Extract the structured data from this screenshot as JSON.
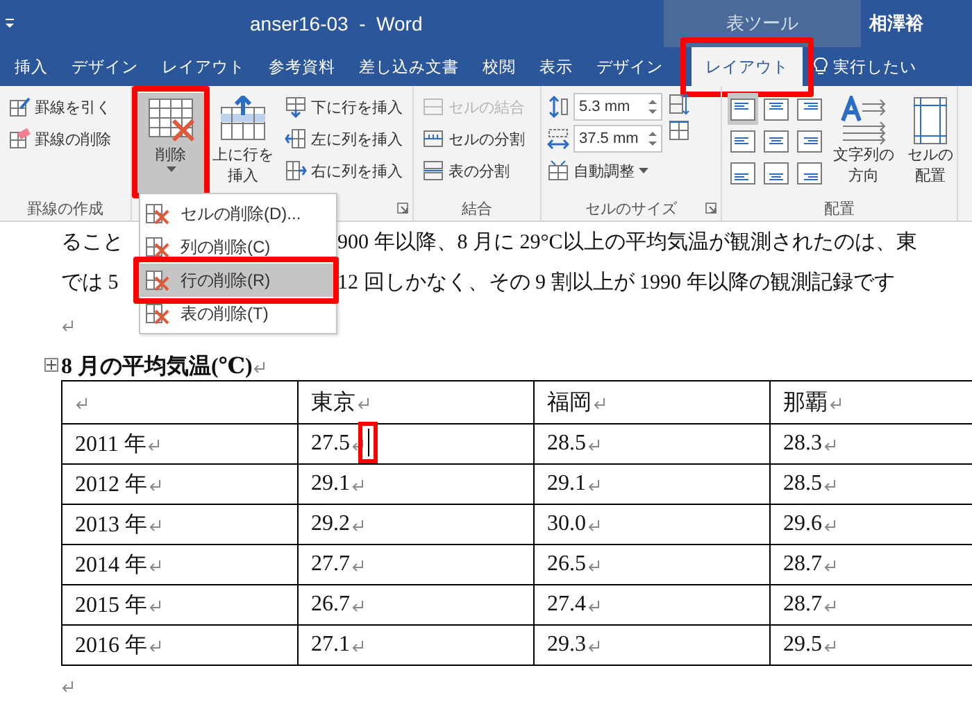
{
  "title_bar": {
    "document_title": "anser16-03  -  Word",
    "context_label": "表ツール",
    "user": "相澤裕"
  },
  "tabs": [
    {
      "label": "挿入",
      "selected": false,
      "highlighted": false
    },
    {
      "label": "デザイン",
      "selected": false,
      "highlighted": false
    },
    {
      "label": "レイアウト",
      "selected": false,
      "highlighted": false
    },
    {
      "label": "参考資料",
      "selected": false,
      "highlighted": false
    },
    {
      "label": "差し込み文書",
      "selected": false,
      "highlighted": false
    },
    {
      "label": "校閲",
      "selected": false,
      "highlighted": false
    },
    {
      "label": "表示",
      "selected": false,
      "highlighted": false
    },
    {
      "label": "デザイン",
      "selected": false,
      "highlighted": false
    },
    {
      "label": "レイアウト",
      "selected": true,
      "highlighted": true
    }
  ],
  "tell_me": {
    "label": "実行したい"
  },
  "ribbon": {
    "groups": [
      {
        "label": "罫線の作成",
        "launcher": false,
        "items": [
          {
            "kind": "small",
            "label": "罫線を引く",
            "disabled": false
          },
          {
            "kind": "small",
            "label": "罫線の削除",
            "disabled": false
          }
        ]
      },
      {
        "launcher": true,
        "items": [
          {
            "kind": "large_menu",
            "lines": [
              "削除"
            ],
            "pressed": true,
            "highlighted": true
          },
          {
            "kind": "large",
            "lines": [
              "上に行を",
              "挿入"
            ]
          },
          {
            "kind": "small",
            "label": "下に行を挿入",
            "disabled": false
          },
          {
            "kind": "small",
            "label": "左に列を挿入",
            "disabled": false
          },
          {
            "kind": "small",
            "label": "右に列を挿入",
            "disabled": false
          }
        ]
      },
      {
        "label": "結合",
        "launcher": false,
        "items": [
          {
            "kind": "small",
            "label": "セルの結合",
            "disabled": true
          },
          {
            "kind": "small",
            "label": "セルの分割",
            "disabled": false
          },
          {
            "kind": "small",
            "label": "表の分割",
            "disabled": false
          }
        ]
      },
      {
        "label": "セルのサイズ",
        "launcher": true,
        "items": [
          {
            "kind": "spin",
            "value": "5.3 mm"
          },
          {
            "kind": "spin",
            "value": "37.5 mm"
          },
          {
            "kind": "dropdown",
            "label": "自動調整"
          },
          {
            "kind": "icon"
          },
          {
            "kind": "icon"
          }
        ]
      },
      {
        "label": "配置",
        "launcher": false,
        "items": [
          {
            "kind": "align",
            "selected": true
          },
          {
            "kind": "align",
            "selected": false
          },
          {
            "kind": "align",
            "selected": false
          },
          {
            "kind": "align",
            "selected": false
          },
          {
            "kind": "align",
            "selected": false
          },
          {
            "kind": "align",
            "selected": false
          },
          {
            "kind": "align",
            "selected": false
          },
          {
            "kind": "align",
            "selected": false
          },
          {
            "kind": "align",
            "selected": false
          },
          {
            "kind": "large",
            "lines": [
              "文字列の",
              "方向"
            ]
          },
          {
            "kind": "large",
            "lines": [
              "セルの",
              "配置"
            ]
          }
        ]
      }
    ]
  },
  "delete_menu": {
    "items": [
      {
        "label": "セルの削除(D)...",
        "selected": false,
        "highlighted": false
      },
      {
        "label": "列の削除(C)",
        "selected": false,
        "highlighted": false
      },
      {
        "label": "行の削除(R)",
        "selected": true,
        "highlighted": true
      },
      {
        "label": "表の削除(T)",
        "selected": false,
        "highlighted": false
      }
    ]
  },
  "document": {
    "lines": [
      {
        "before": "ること",
        "after": "900 年以降、8 月に 29°C以上の平均気温が観測されたのは、東"
      },
      {
        "before": "では 5",
        "after": "12 回しかなく、その 9 割以上が 1990 年以降の観測記録です"
      }
    ],
    "caption": "8 月の平均気温(℃)",
    "table": {
      "columns": [
        {
          "text": ""
        },
        {
          "text": "東京"
        },
        {
          "text": "福岡"
        },
        {
          "text": "那覇"
        }
      ],
      "rows": [
        [
          {
            "text": "2011 年",
            "cursor": false
          },
          {
            "text": "27.5",
            "cursor": true
          },
          {
            "text": "28.5",
            "cursor": false
          },
          {
            "text": "28.3",
            "cursor": false
          }
        ],
        [
          {
            "text": "2012 年",
            "cursor": false
          },
          {
            "text": "29.1",
            "cursor": false
          },
          {
            "text": "29.1",
            "cursor": false
          },
          {
            "text": "28.5",
            "cursor": false
          }
        ],
        [
          {
            "text": "2013 年",
            "cursor": false
          },
          {
            "text": "29.2",
            "cursor": false
          },
          {
            "text": "30.0",
            "cursor": false
          },
          {
            "text": "29.6",
            "cursor": false
          }
        ],
        [
          {
            "text": "2014 年",
            "cursor": false
          },
          {
            "text": "27.7",
            "cursor": false
          },
          {
            "text": "26.5",
            "cursor": false
          },
          {
            "text": "28.7",
            "cursor": false
          }
        ],
        [
          {
            "text": "2015 年",
            "cursor": false
          },
          {
            "text": "26.7",
            "cursor": false
          },
          {
            "text": "27.4",
            "cursor": false
          },
          {
            "text": "28.7",
            "cursor": false
          }
        ],
        [
          {
            "text": "2016 年",
            "cursor": false
          },
          {
            "text": "27.1",
            "cursor": false
          },
          {
            "text": "29.3",
            "cursor": false
          },
          {
            "text": "29.5",
            "cursor": false
          }
        ]
      ]
    }
  }
}
